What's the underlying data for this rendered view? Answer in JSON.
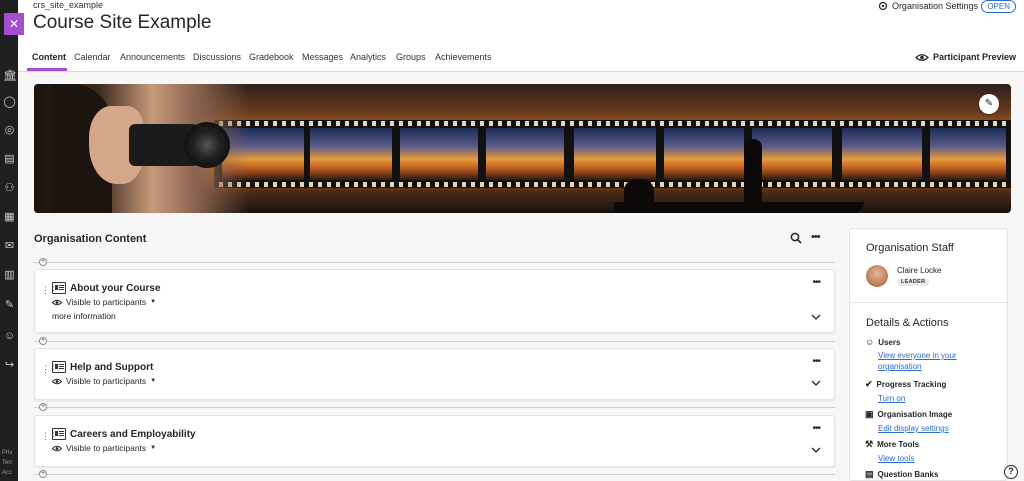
{
  "header": {
    "course_id": "crs_site_example",
    "course_title": "Course Site Example",
    "org_settings_label": "Organisation Settings",
    "status_badge": "OPEN",
    "close_icon": "close-icon"
  },
  "tabs": [
    {
      "label": "Content",
      "active": true
    },
    {
      "label": "Calendar"
    },
    {
      "label": "Announcements"
    },
    {
      "label": "Discussions"
    },
    {
      "label": "Gradebook"
    },
    {
      "label": "Messages"
    },
    {
      "label": "Analytics"
    },
    {
      "label": "Groups"
    },
    {
      "label": "Achievements"
    }
  ],
  "participant_preview": "Participant Preview",
  "content": {
    "section_title": "Organisation Content",
    "cards": [
      {
        "title": "About your Course",
        "visibility": "Visible to participants",
        "extra": "more information"
      },
      {
        "title": "Help and Support",
        "visibility": "Visible to participants"
      },
      {
        "title": "Careers and Employability",
        "visibility": "Visible to participants"
      }
    ]
  },
  "panel": {
    "staff_title": "Organisation Staff",
    "staff_name": "Claire Locke",
    "staff_role": "LEADER",
    "details_title": "Details & Actions",
    "items": [
      {
        "label": "Users",
        "link": "View everyone in your organisation",
        "icon": "users-icon"
      },
      {
        "label": "Progress Tracking",
        "link": "Turn on",
        "icon": "progress-check-icon"
      },
      {
        "label": "Organisation Image",
        "link": "Edit display settings",
        "icon": "image-icon"
      },
      {
        "label": "More Tools",
        "link": "View tools",
        "icon": "tools-icon"
      },
      {
        "label": "Question Banks",
        "link": "",
        "icon": "question-bank-icon"
      }
    ]
  },
  "rail_footer": [
    "Priv",
    "Terr",
    "Acc"
  ],
  "colors": {
    "accent": "#a34ecf",
    "link": "#2a6bd1",
    "rail": "#1f1f1f"
  }
}
